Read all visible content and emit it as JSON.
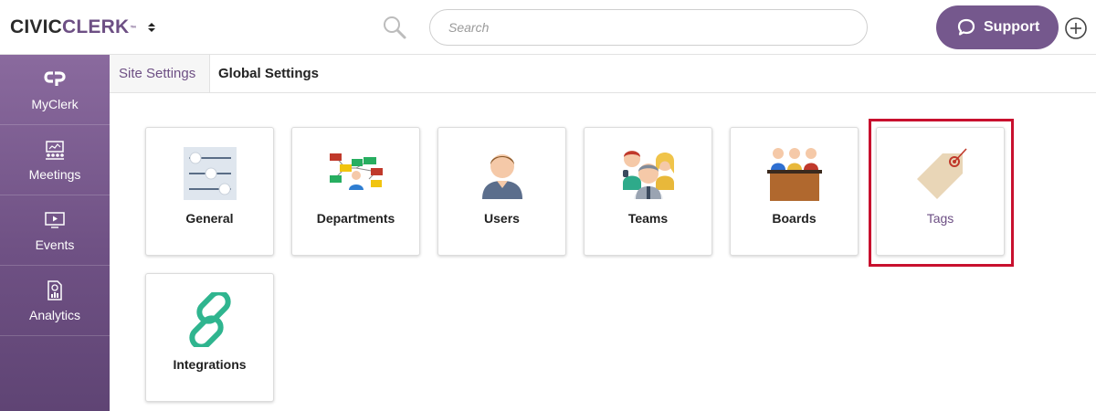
{
  "header": {
    "logo_part1": "CIVIC",
    "logo_part2": "CLERK",
    "logo_tm": "™",
    "search_placeholder": "Search",
    "support_label": "Support",
    "icons": {
      "org_switch": "sort-arrows-icon",
      "search": "magnifier-icon",
      "support": "chat-bubble-icon",
      "add": "plus-circle-icon"
    }
  },
  "sidebar": {
    "items": [
      {
        "label": "MyClerk",
        "icon": "civicplus-logo-icon"
      },
      {
        "label": "Meetings",
        "icon": "meeting-board-icon"
      },
      {
        "label": "Events",
        "icon": "video-player-icon"
      },
      {
        "label": "Analytics",
        "icon": "report-chart-icon"
      }
    ]
  },
  "tabs": {
    "site": "Site Settings",
    "global": "Global Settings"
  },
  "tiles": [
    {
      "label": "General",
      "icon": "sliders-icon"
    },
    {
      "label": "Departments",
      "icon": "org-chart-icon"
    },
    {
      "label": "Users",
      "icon": "user-icon"
    },
    {
      "label": "Teams",
      "icon": "team-icon"
    },
    {
      "label": "Boards",
      "icon": "board-members-icon"
    },
    {
      "label": "Tags",
      "icon": "tag-icon"
    },
    {
      "label": "Integrations",
      "icon": "chain-link-icon"
    }
  ],
  "colors": {
    "brand_purple": "#75588d",
    "highlight_red": "#c8102e"
  }
}
